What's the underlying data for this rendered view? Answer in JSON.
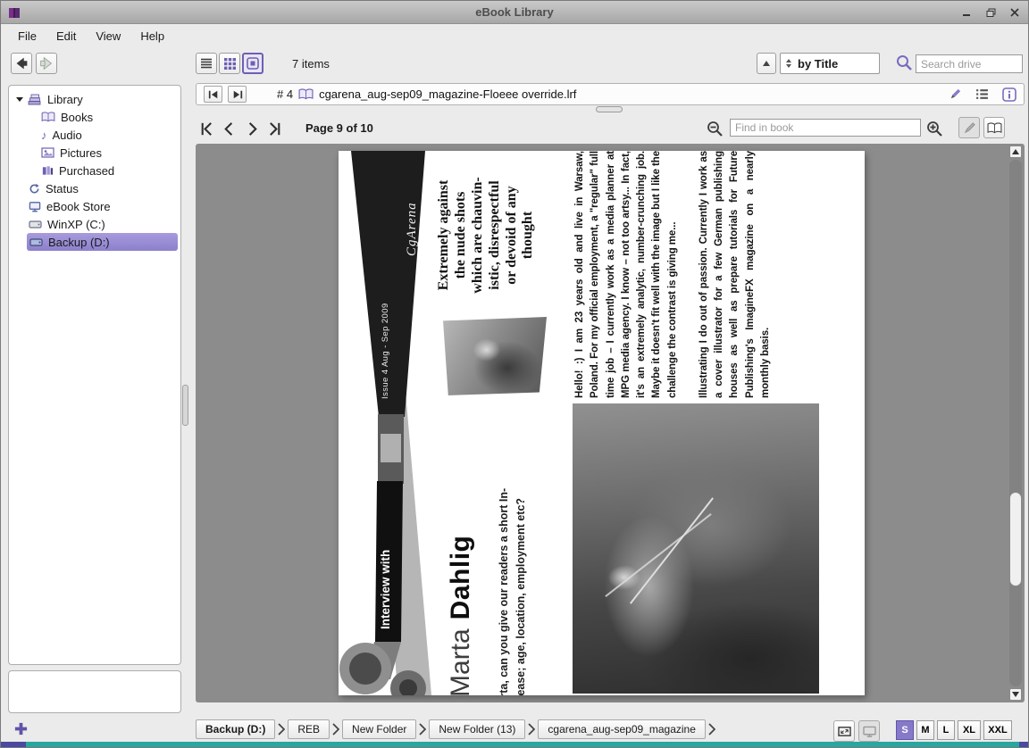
{
  "window": {
    "title": "eBook Library"
  },
  "menu": {
    "items": [
      "File",
      "Edit",
      "View",
      "Help"
    ]
  },
  "toolbar": {
    "items_count": "7 items",
    "sort_label": "by Title",
    "search_placeholder": "Search drive"
  },
  "sidebar": {
    "root_label": "Library",
    "children": [
      "Books",
      "Audio",
      "Pictures",
      "Purchased"
    ],
    "nodes": [
      "Status",
      "eBook Store",
      "WinXP (C:)",
      "Backup (D:)"
    ],
    "selected": "Backup (D:)"
  },
  "book_bar": {
    "index": "# 4",
    "title": "cgarena_aug-sep09_magazine-Floeee override.lrf"
  },
  "reader_bar": {
    "page_indicator": "Page 9 of 10",
    "find_placeholder": "Find in book"
  },
  "page": {
    "brand": "CgArena",
    "issue": "Issue 4 Aug - Sep 2009",
    "quote_lines": [
      "Extremely against",
      "the nude shots",
      "which are chauvin-",
      "istic, disrespectful",
      "or devoid of any",
      "thought"
    ],
    "interview_label": "Interview with",
    "headline_first": "Marta",
    "headline_last": "Dahlig",
    "question_lines": [
      "ello Marta, can you give our readers a short In-",
      "ction please; age, location, employment etc?"
    ],
    "body_paragraphs": [
      "Hello! :) I am 23 years old and live in Warsaw, Poland. For my official employment, a \"regular\" full time job – I currently work as a media planner at MPG media agency. I know – not too artsy... In fact, it's an extremely analytic, number-crunching job. Maybe it doesn't fit well with the image but I like the challenge the contrast is giving me...",
      "Illustrating I do out of passion. Currently I work as a cover illustrator for a few German publishing houses as well as prepare tutorials for Future Publishing's ImagineFX magazine on a nearly monthly basis."
    ]
  },
  "breadcrumb": {
    "items": [
      "Backup (D:)",
      "REB",
      "New Folder",
      "New Folder (13)",
      "cgarena_aug-sep09_magazine"
    ]
  },
  "sizes": {
    "options": [
      "S",
      "M",
      "L",
      "XL",
      "XXL"
    ],
    "selected": "S"
  },
  "colors": {
    "accent_purple": "#6e60b2",
    "selection_purple": "#968ad2",
    "taskbar_teal": "#2aa6a0"
  }
}
